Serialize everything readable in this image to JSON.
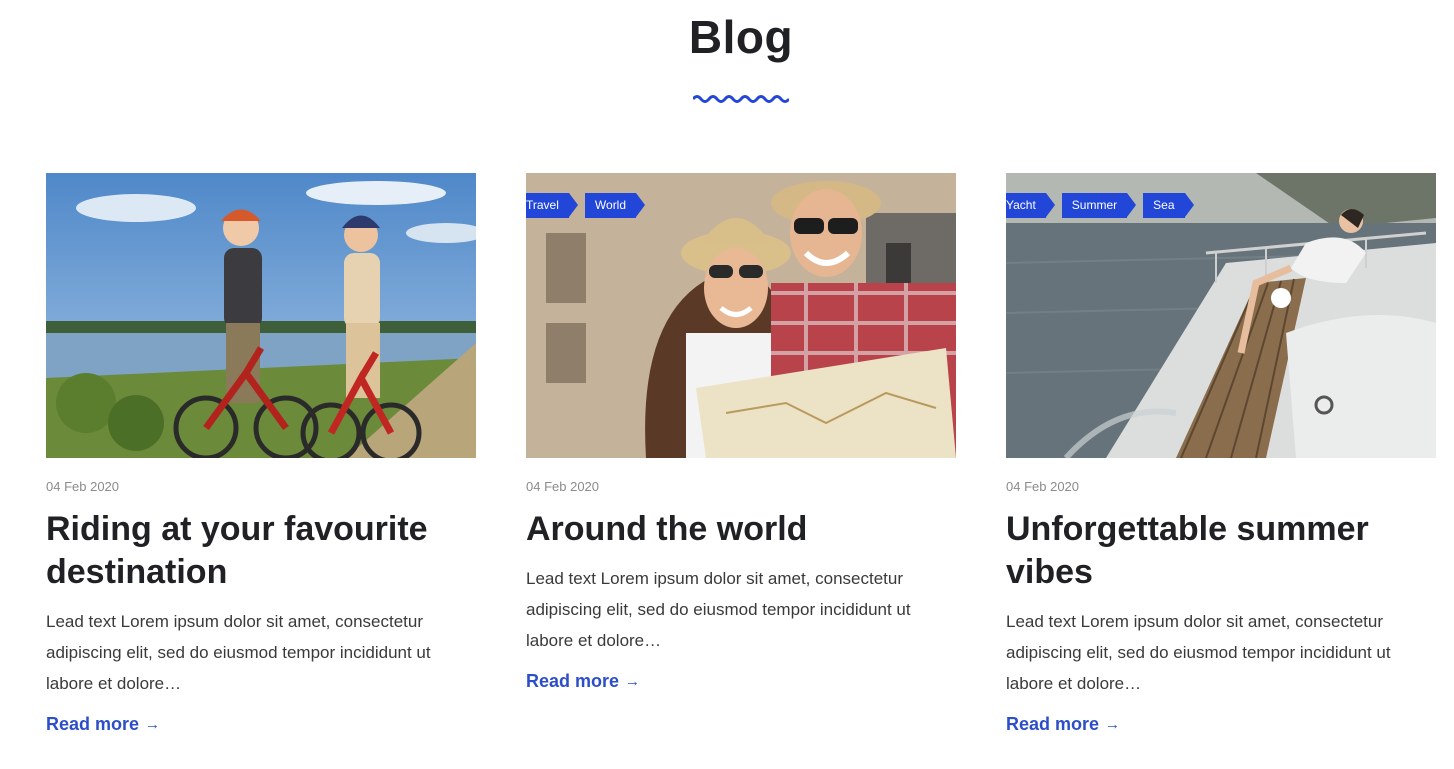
{
  "section": {
    "title": "Blog"
  },
  "posts": [
    {
      "tags": [],
      "date": "04 Feb 2020",
      "title": "Riding at your favourite destination",
      "lead": "Lead text Lorem ipsum dolor sit amet, consectetur adipiscing elit, sed do eiusmod tempor incididunt ut labore et dolore…",
      "read_more": "Read more",
      "arrow": "→"
    },
    {
      "tags": [
        "Travel",
        "World"
      ],
      "date": "04 Feb 2020",
      "title": "Around the world",
      "lead": "Lead text Lorem ipsum dolor sit amet, consectetur adipiscing elit, sed do eiusmod tempor incididunt ut labore et dolore…",
      "read_more": "Read more",
      "arrow": "→"
    },
    {
      "tags": [
        "Yacht",
        "Summer",
        "Sea"
      ],
      "date": "04 Feb 2020",
      "title": "Unforgettable summer vibes",
      "lead": "Lead text Lorem ipsum dolor sit amet, consectetur adipiscing elit, sed do eiusmod tempor incididunt ut labore et dolore…",
      "read_more": "Read more",
      "arrow": "→"
    }
  ],
  "colors": {
    "accent": "#2146d8",
    "link": "#2c4fc9",
    "heading": "#1f2124",
    "muted": "#8b8b8b"
  }
}
